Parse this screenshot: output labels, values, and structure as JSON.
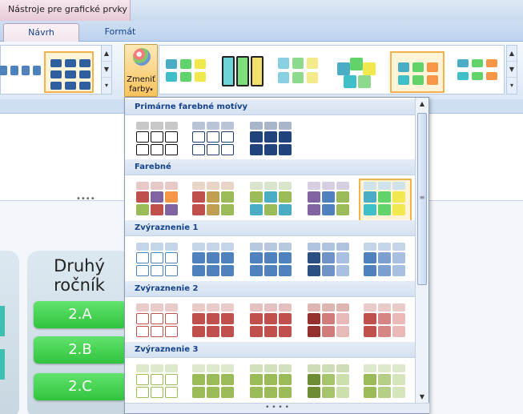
{
  "contextual_tab_title": "Nástroje pre grafické prvky SmartArt",
  "tabs": [
    {
      "label": "Návrh",
      "active": true
    },
    {
      "label": "Formát",
      "active": false
    }
  ],
  "ribbon": {
    "change_colors_label": "Zmeniť farby",
    "change_colors_line1": "Zmeniť",
    "change_colors_line2": "farby"
  },
  "colors": {
    "accent_selected": "#f6b24a",
    "section_header_text": "#15428b",
    "pill_green": "#3ecb4b"
  },
  "dropdown": {
    "sections": [
      {
        "title": "Primárne farebné motívy",
        "swatches": [
          {
            "outline": "#111111",
            "fill": "#ffffff",
            "header": "#c8c8c8",
            "style": "outline"
          },
          {
            "outline": "#1f3f73",
            "fill": "#ffffff",
            "header": "#b9c5d6",
            "style": "outline"
          },
          {
            "outline": "#1f3f73",
            "fill": "#22447d",
            "header": "#a9b6c9",
            "style": "solid"
          }
        ]
      },
      {
        "title": "Farebné",
        "swatches": [
          {
            "style": "multi",
            "colors": [
              "#c0504d",
              "#8064a2",
              "#f79646",
              "#9bbb59",
              "#c0504d",
              "#8064a2"
            ],
            "header": "#e8c9c8"
          },
          {
            "style": "multi",
            "colors": [
              "#c0504d",
              "#c0a050",
              "#9bbb59",
              "#c0504d",
              "#c0a050",
              "#9bbb59"
            ],
            "header": "#e8d5c8"
          },
          {
            "style": "multi",
            "colors": [
              "#9bbb59",
              "#4bacc6",
              "#9bbb59",
              "#4bacc6",
              "#9bbb59",
              "#4bacc6"
            ],
            "header": "#d8e4cc"
          },
          {
            "style": "multi",
            "colors": [
              "#8064a2",
              "#4f81bd",
              "#9bbb59",
              "#8064a2",
              "#4f81bd",
              "#9bbb59"
            ],
            "header": "#d6cfe2"
          },
          {
            "style": "multi",
            "colors": [
              "#4bacc6",
              "#62d36a",
              "#f2e94f",
              "#3fc0c8",
              "#62d36a",
              "#f2e94f"
            ],
            "header": "#cfe3ee",
            "selected": true
          }
        ]
      },
      {
        "title": "Zvýraznenie 1",
        "swatches": [
          {
            "style": "outline",
            "outline": "#4f81bd",
            "fill": "#ffffff",
            "header": "#c5d4e8"
          },
          {
            "style": "solid",
            "outline": "#4f81bd",
            "fill": "#4f81bd",
            "header": "#c5d4e8"
          },
          {
            "style": "solid",
            "outline": "#4f81bd",
            "fill": "#4f81bd",
            "header": "#b8c8de"
          },
          {
            "style": "grad",
            "colors": [
              "#2a4f80",
              "#6f93c4",
              "#a9c0e0"
            ],
            "header": "#b0c3dc"
          },
          {
            "style": "grad",
            "colors": [
              "#4f81bd",
              "#7d9fcf",
              "#a9c0e0"
            ],
            "header": "#c5d4e8"
          }
        ]
      },
      {
        "title": "Zvýraznenie 2",
        "swatches": [
          {
            "style": "outline",
            "outline": "#c0504d",
            "fill": "#ffffff",
            "header": "#ebcaca"
          },
          {
            "style": "solid",
            "outline": "#c0504d",
            "fill": "#c0504d",
            "header": "#ebcaca"
          },
          {
            "style": "solid",
            "outline": "#c0504d",
            "fill": "#c0504d",
            "header": "#e4c0c0"
          },
          {
            "style": "grad",
            "colors": [
              "#94302d",
              "#cf7c7a",
              "#e7b9b8"
            ],
            "header": "#dfb5b4"
          },
          {
            "style": "grad",
            "colors": [
              "#c0504d",
              "#d58684",
              "#ebb9b8"
            ],
            "header": "#ebcaca"
          }
        ]
      },
      {
        "title": "Zvýraznenie 3",
        "swatches": [
          {
            "style": "outline",
            "outline": "#9bbb59",
            "fill": "#ffffff",
            "header": "#dde8cc"
          },
          {
            "style": "solid",
            "outline": "#9bbb59",
            "fill": "#9bbb59",
            "header": "#dde8cc"
          },
          {
            "style": "solid",
            "outline": "#9bbb59",
            "fill": "#9bbb59",
            "header": "#d3e0be"
          },
          {
            "style": "grad",
            "colors": [
              "#6e8c34",
              "#a6c46e",
              "#cddfac"
            ],
            "header": "#cfddb6"
          },
          {
            "style": "grad",
            "colors": [
              "#9bbb59",
              "#b6cf86",
              "#d6e5bb"
            ],
            "header": "#dde8cc"
          }
        ]
      }
    ]
  },
  "document": {
    "column_title_line1": "Druhý",
    "column_title_line2": "ročník",
    "classes": [
      "2.A",
      "2.B",
      "2.C"
    ]
  }
}
